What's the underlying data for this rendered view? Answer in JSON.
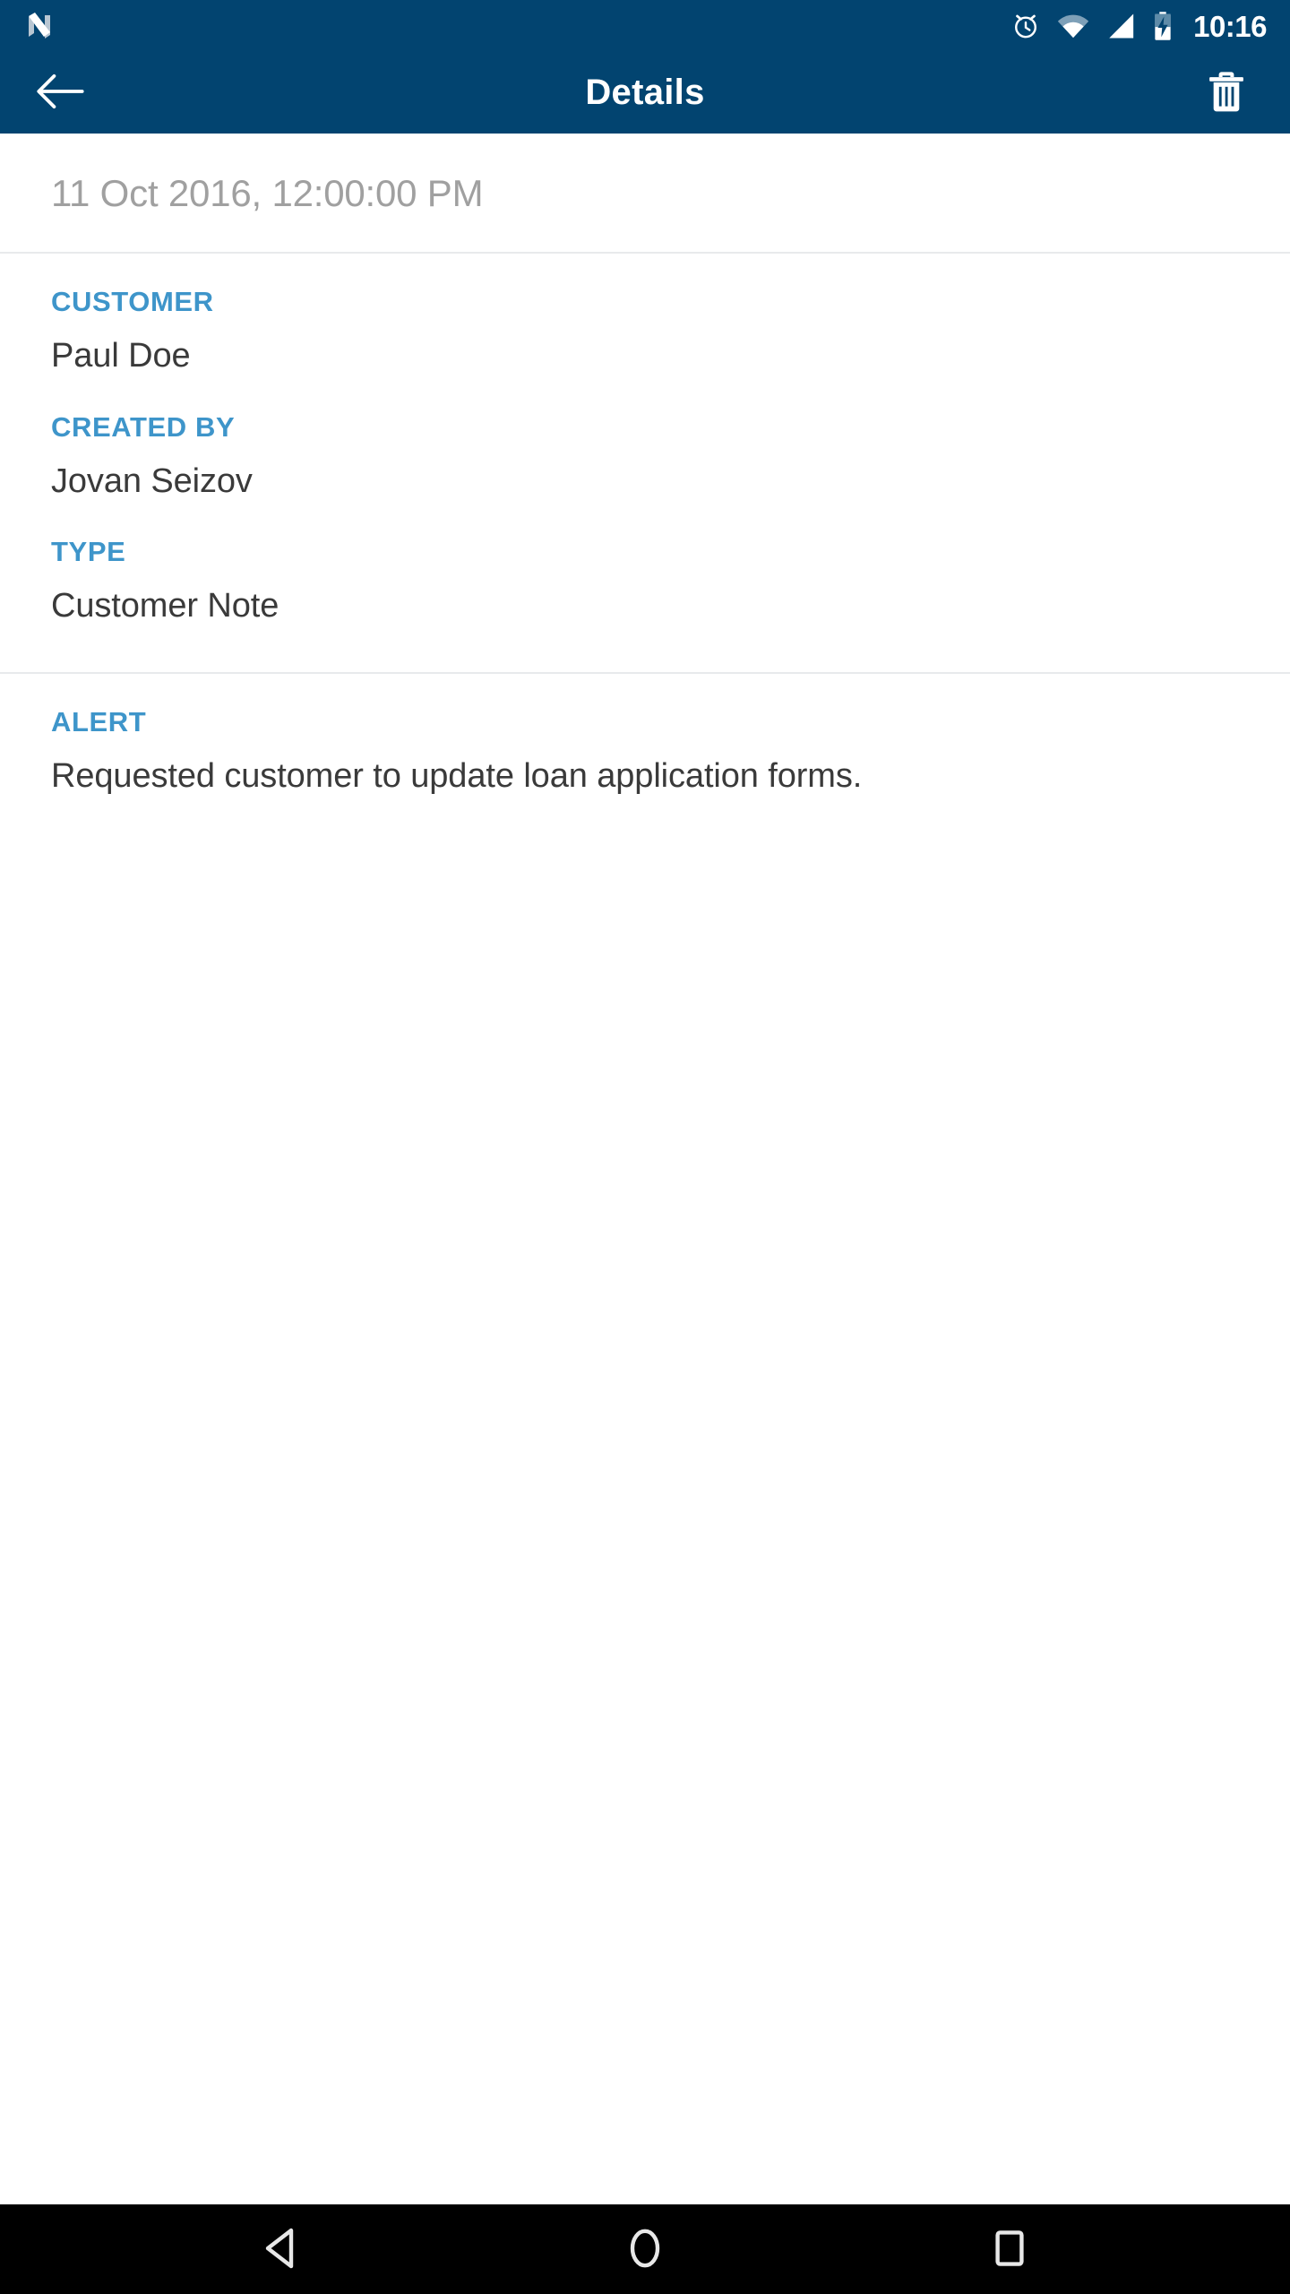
{
  "status_bar": {
    "notification_icon": "android-nougat-logo",
    "icons": [
      "alarm-icon",
      "wifi-icon",
      "cellular-signal-icon",
      "battery-charging-icon"
    ],
    "time": "10:16",
    "background_color": "#024470"
  },
  "app_bar": {
    "back_icon": "arrow-left-icon",
    "title": "Details",
    "delete_icon": "trash-icon",
    "background_color": "#024470",
    "title_color": "#ffffff"
  },
  "detail": {
    "timestamp": "11 Oct 2016, 12:00:00 PM",
    "timestamp_color": "#a0a0a0",
    "label_color": "#3e95ca",
    "value_color": "#3a3a3a",
    "fields": [
      {
        "label": "CUSTOMER",
        "value": "Paul Doe"
      },
      {
        "label": "CREATED BY",
        "value": "Jovan Seizov"
      },
      {
        "label": "TYPE",
        "value": "Customer Note"
      }
    ],
    "alert": {
      "label": "ALERT",
      "value": "Requested customer to update loan application forms."
    }
  },
  "nav_bar": {
    "back": "nav-back-icon",
    "home": "nav-home-icon",
    "recents": "nav-recents-icon",
    "background_color": "#000000"
  }
}
